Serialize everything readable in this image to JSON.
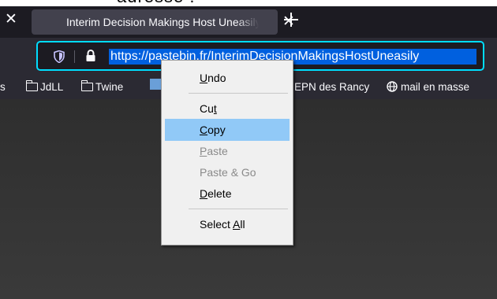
{
  "tab": {
    "title": "Interim Decision Makings Host Uneasily"
  },
  "urlbar": {
    "url": "https://pastebin.fr/InterimDecisionMakingsHostUneasily"
  },
  "bookmarks": [
    "s",
    "JdLL",
    "Twine",
    "EPN des Rancy",
    "mail en masse"
  ],
  "context_menu": {
    "items": [
      {
        "label": "Undo",
        "accel": "U",
        "state": "enabled"
      },
      {
        "label": "Cut",
        "accel": "t",
        "state": "enabled"
      },
      {
        "label": "Copy",
        "accel": "C",
        "state": "highlighted"
      },
      {
        "label": "Paste",
        "accel": "P",
        "state": "disabled"
      },
      {
        "label": "Paste & Go",
        "accel": "",
        "state": "disabled"
      },
      {
        "label": "Delete",
        "accel": "D",
        "state": "enabled"
      },
      {
        "label": "Select All",
        "accel": "A",
        "state": "enabled"
      }
    ]
  },
  "colors": {
    "accent": "#00ddff",
    "selection": "#0060df",
    "menu_highlight": "#91c9f7"
  }
}
